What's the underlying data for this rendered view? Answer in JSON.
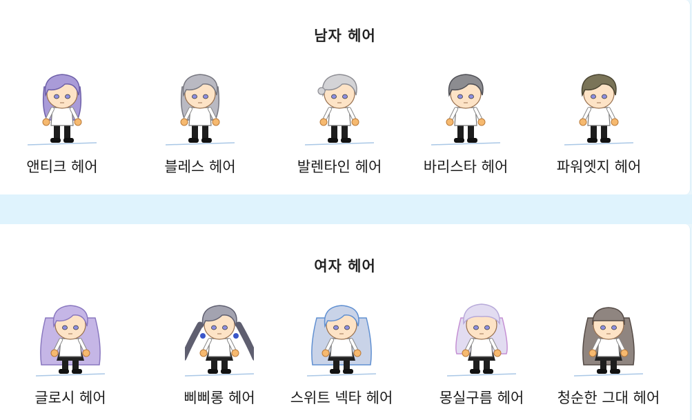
{
  "sections": [
    {
      "title": "남자 헤어",
      "items": [
        {
          "label": "앤티크 헤어",
          "hair_color": "#a99bd8",
          "hair_dark": "#6d5fa8",
          "icon": "male-long-hair-character-icon"
        },
        {
          "label": "블레스 헤어",
          "hair_color": "#b9b9c2",
          "hair_dark": "#76767f",
          "icon": "male-side-swept-hair-character-icon"
        },
        {
          "label": "발렌타인 헤어",
          "hair_color": "#d3d3d6",
          "hair_dark": "#8e8e94",
          "icon": "male-tied-hair-character-icon"
        },
        {
          "label": "바리스타 헤어",
          "hair_color": "#8c8c90",
          "hair_dark": "#4f4f55",
          "icon": "male-wavy-hair-character-icon"
        },
        {
          "label": "파워엣지 헤어",
          "hair_color": "#7a7458",
          "hair_dark": "#4a4532",
          "icon": "male-short-hair-character-icon"
        }
      ]
    },
    {
      "title": "여자 헤어",
      "items": [
        {
          "label": "글로시 헤어",
          "hair_color": "#c5b6e6",
          "hair_dark": "#8977bf",
          "icon": "female-long-hair-character-icon"
        },
        {
          "label": "삐삐롱 헤어",
          "hair_color": "#a3a3b0",
          "hair_dark": "#5f5f70",
          "icon": "female-braided-hair-character-icon"
        },
        {
          "label": "스위트 넥타 헤어",
          "hair_color": "#c9d3e8",
          "hair_dark": "#5f8fd1",
          "icon": "female-curly-hair-character-icon"
        },
        {
          "label": "몽실구름 헤어",
          "hair_color": "#e2dcf1",
          "hair_dark": "#c48ed3",
          "icon": "female-cloud-hair-character-icon"
        },
        {
          "label": "청순한 그대 헤어",
          "hair_color": "#8f8580",
          "hair_dark": "#544a45",
          "icon": "female-straight-hair-character-icon"
        }
      ]
    }
  ]
}
